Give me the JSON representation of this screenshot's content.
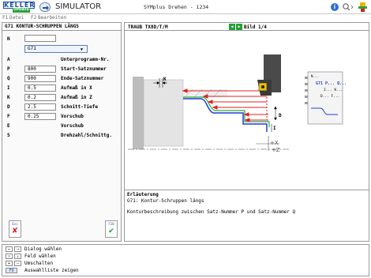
{
  "titlebar": {
    "logo_text": "KELLER",
    "logo_badge": "UPDATE",
    "app_name": "SIMULATOR",
    "window_title": "SYMplus Drehen - 1234"
  },
  "menu": {
    "items": [
      {
        "key": "F1",
        "label": "Datei"
      },
      {
        "key": "F2",
        "label": "Bearbeiten"
      }
    ]
  },
  "cycle": {
    "title": "G71 KONTUR-SCHRUPPEN LÄNGS",
    "selected_option": "G71",
    "params": [
      {
        "key": "A",
        "value": "",
        "desc": "Unterprogramm-Nr."
      },
      {
        "key": "P",
        "value": "800",
        "desc": "Start-Satznummer"
      },
      {
        "key": "Q",
        "value": "900",
        "desc": "Ende-Satznummer"
      },
      {
        "key": "I",
        "value": "0.5",
        "desc": "Aufmaß in X"
      },
      {
        "key": "K",
        "value": "0.2",
        "desc": "Aufmaß in Z"
      },
      {
        "key": "D",
        "value": "2.5",
        "desc": "Schnitt-Tiefe"
      },
      {
        "key": "F",
        "value": "0.25",
        "desc": "Vorschub"
      },
      {
        "key": "E",
        "value": "",
        "desc": "Vorschub"
      },
      {
        "key": "S",
        "value": "",
        "desc": "Drehzahl/Schnittg."
      }
    ]
  },
  "buttons": {
    "esc_label": "Esc",
    "f10_label": "F10"
  },
  "graphic": {
    "header_label": "TRAUB TX8D/T/M",
    "page_indicator": "Bild 1/4",
    "dim_labels": [
      "K",
      "I",
      "D"
    ],
    "axis_labels": [
      "+X",
      "+Z"
    ],
    "mini_text": [
      "N...",
      "G71 P... Q...",
      "I... K...",
      "D... F..."
    ]
  },
  "explanation": {
    "title": "Erläuterung",
    "line1": "G71: Kontur-Schruppen längs",
    "line2": "Konturbeschreibung zwischen Satz-Nummer P und Satz-Nummer Q"
  },
  "help": {
    "rows": [
      {
        "k1": "←",
        "k2": "→",
        "text": "Dialog wählen"
      },
      {
        "k1": "↑",
        "k2": "↓",
        "text": "Feld wählen"
      },
      {
        "k1": "+",
        "k2": "−",
        "text": "Umschalten"
      },
      {
        "k1": "F9",
        "k2": "",
        "text": "Auswahlliste zeigen"
      }
    ]
  },
  "colors": {
    "brand_blue": "#1c4fa0",
    "update_green": "#2aa33d",
    "rough_pass_red": "#e02020",
    "finish_green": "#2aa840",
    "contour_blue": "#1f3fd0"
  }
}
